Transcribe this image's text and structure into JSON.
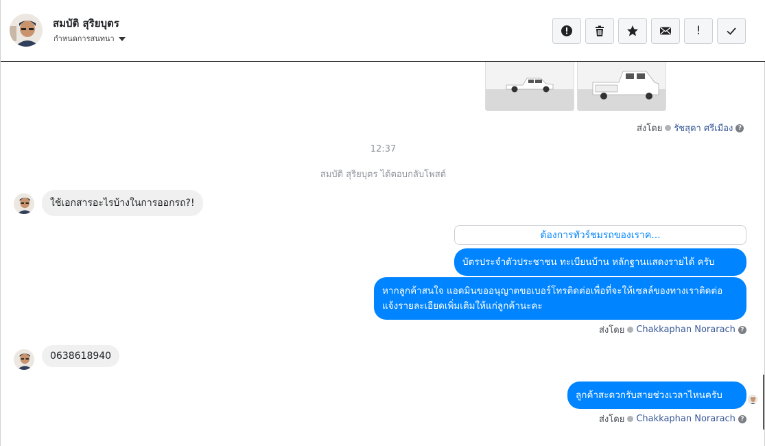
{
  "header": {
    "contact_name": "สมบัติ สุริยบุตร",
    "assign_label": "กำหนดการสนทนา",
    "tools": [
      {
        "icon": "alert-circle-icon",
        "name": "spam-button"
      },
      {
        "icon": "trash-icon",
        "name": "delete-button"
      },
      {
        "icon": "star-icon",
        "name": "star-button"
      },
      {
        "icon": "mail-icon",
        "name": "unread-button"
      },
      {
        "icon": "exclamation-icon",
        "name": "follow-up-button",
        "glyph": "!"
      },
      {
        "icon": "check-icon",
        "name": "done-button"
      }
    ]
  },
  "conversation": {
    "sent_by_label": "ส่งโดย",
    "sent_by_1": "รัชสุดา ศรีเมือง",
    "timestamp": "12:37",
    "notice": "สมบัติ สุริยบุตร ได้ตอบกลับโพสต์",
    "incoming_1": "ใช้เอกสารอะไรบ้างในการออกรถ?!",
    "quick_reply": "ต้องการทัวร์ชมรถของเราค...",
    "outgoing_1": "บัตรประจำตัวประชาชน ทะเบียนบ้าน หลักฐานแสดงรายได้ ครับ",
    "outgoing_2": "หากลูกค้าสนใจ แอดมินขออนุญาตขอเบอร์โทรติดต่อเพื่อที่จะให้เซลล์ของทางเราติดต่อแจ้งรายละเอียดเพิ่มเติมให้แก่ลูกค้านะคะ",
    "sent_by_2": "Chakkaphan Norarach",
    "incoming_2": "0638618940",
    "outgoing_3": "ลูกค้าสะดวกรับสายช่วงเวลาไหนครับ",
    "sent_by_3": "Chakkaphan Norarach",
    "help_glyph": "?"
  },
  "colors": {
    "accent": "#0084ff",
    "incoming_bg": "#f0f0f0",
    "link": "#385898"
  }
}
